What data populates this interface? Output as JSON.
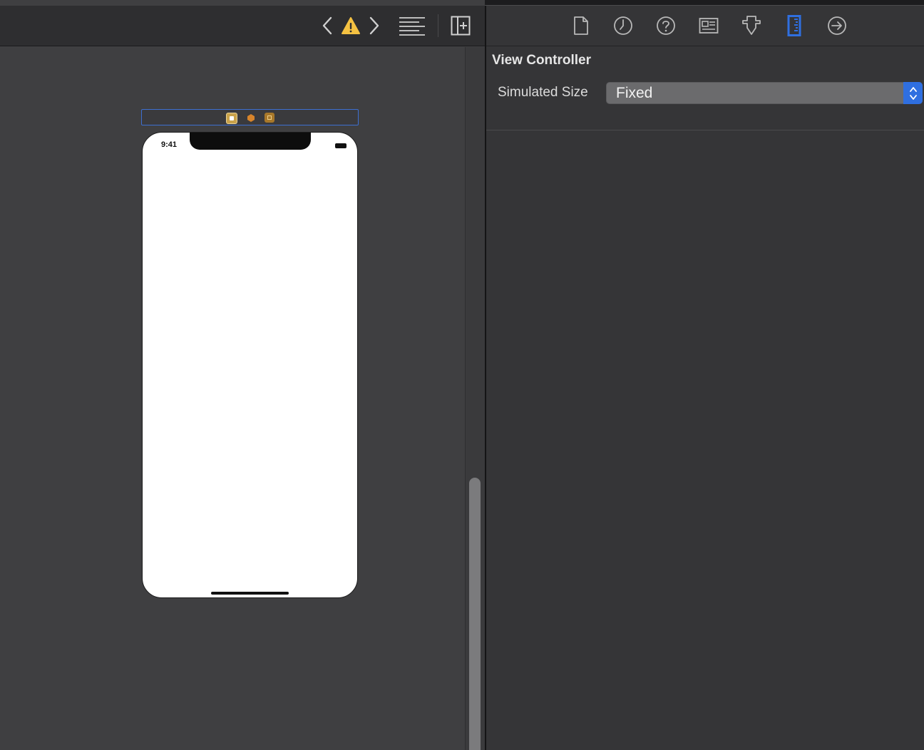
{
  "device": {
    "status_time": "9:41"
  },
  "inspector": {
    "section_title": "View Controller",
    "simulated_size_label": "Simulated Size",
    "simulated_size_value": "Fixed",
    "selected_tab": "size-inspector",
    "tabs": [
      "file-inspector",
      "history-inspector",
      "quick-help-inspector",
      "identity-inspector",
      "attributes-inspector",
      "size-inspector",
      "connections-inspector"
    ]
  },
  "toolbar": {
    "icons": [
      "back-chevron-icon",
      "warning-icon",
      "forward-chevron-icon",
      "related-items-icon",
      "add-editor-icon"
    ]
  },
  "colors": {
    "accent": "#2f6fe0",
    "warning": "#f5c242",
    "canvas_bg": "#3f3f41",
    "inspector_bg": "#353537"
  }
}
